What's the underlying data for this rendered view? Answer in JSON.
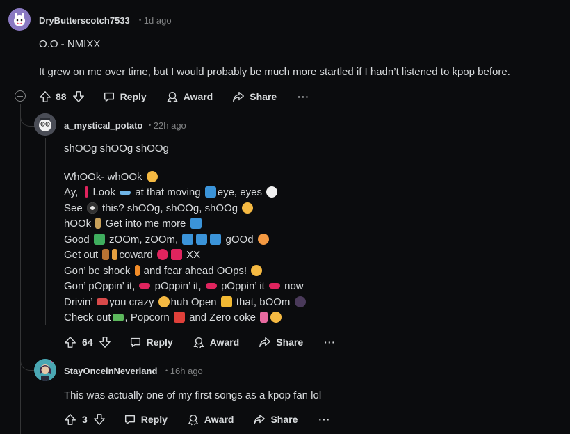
{
  "comments": [
    {
      "username": "DryButterscotch7533",
      "time": "1d ago",
      "paragraphs": [
        "O.O - NMIXX",
        "It grew on me over time, but I would probably be much more startled if I hadn’t listened to kpop before."
      ],
      "votes": "88"
    },
    {
      "username": "a_mystical_potato",
      "time": "22h ago",
      "lines": [
        "shOOg shOOg shOOg",
        "",
        "WhOOk- whOOk",
        "Ay,  Look  at that moving eye, eyes",
        "See  this? shOOg, shOOg, shOOg",
        "hOOk  Get into me more",
        "Good  zOOm, zOOm,    gOOd",
        "Get out   coward   XX",
        "Gon’ be shock  and fear ahead OOps!",
        "Gon’ pOppin’ it,  pOppin’ it,  pOppin’ it  now",
        "Drivin’ you crazy  huh Open  that, bOOm",
        "Check out , Popcorn  and Zero coke"
      ],
      "votes": "64"
    },
    {
      "username": "StayOnceinNeverland",
      "time": "16h ago",
      "paragraphs": [
        "This was actually one of my first songs as a kpop fan lol"
      ],
      "votes": "3"
    }
  ],
  "actions": {
    "reply": "Reply",
    "award": "Award",
    "share": "Share",
    "more": "···"
  },
  "separator": "•",
  "colors": {
    "background": "#0b0c0e",
    "text": "#d7dadc",
    "muted": "#818384",
    "thread": "#343536"
  }
}
